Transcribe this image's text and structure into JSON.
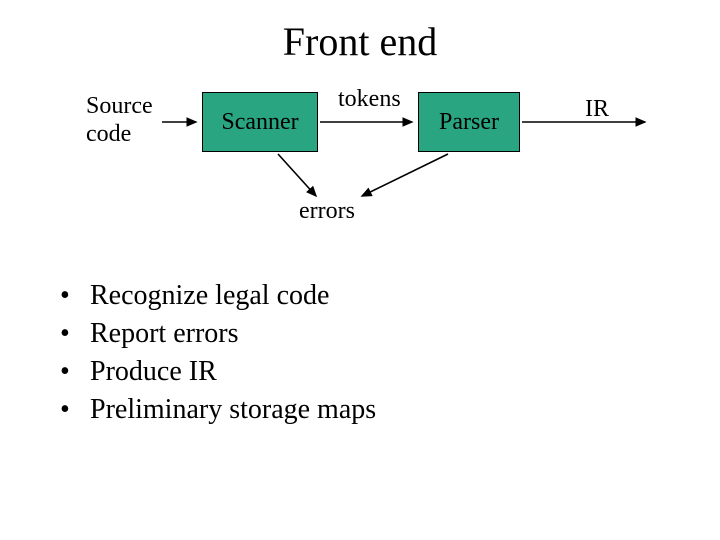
{
  "title": "Front end",
  "diagram": {
    "source_label_line1": "Source",
    "source_label_line2": "code",
    "scanner_label": "Scanner",
    "tokens_label": "tokens",
    "parser_label": "Parser",
    "ir_label": "IR",
    "errors_label": "errors",
    "box_fill": "#2aa581"
  },
  "bullets": [
    "Recognize legal code",
    "Report errors",
    "Produce IR",
    "Preliminary storage maps"
  ]
}
